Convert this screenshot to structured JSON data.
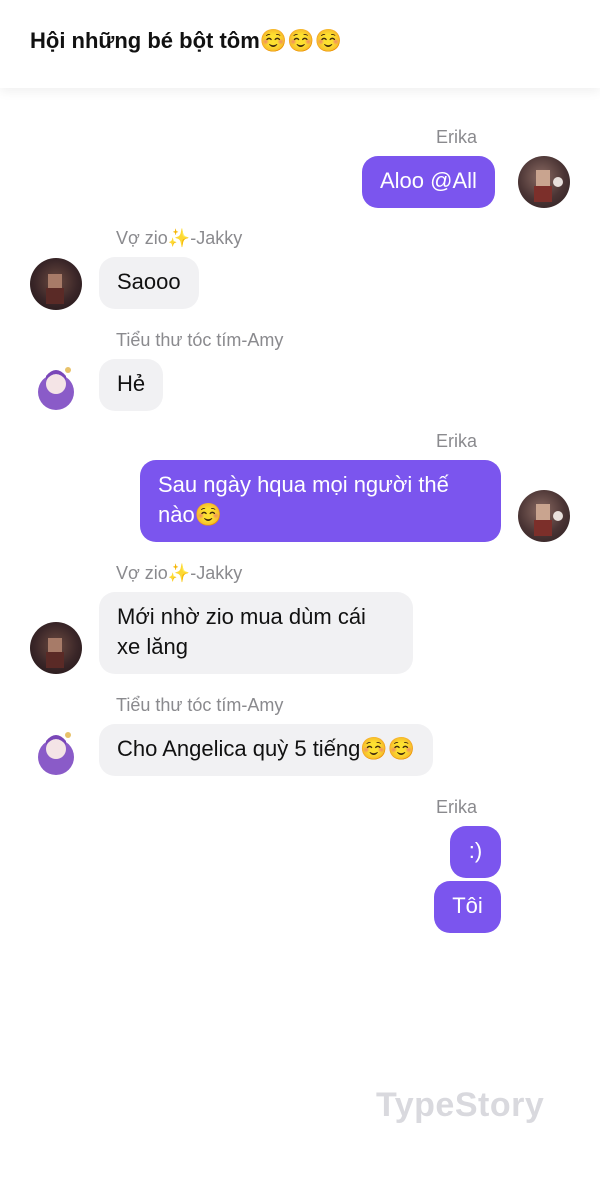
{
  "header": {
    "title": "Hội những bé bột tôm☺️☺️☺️"
  },
  "messages": [
    {
      "sender": "Erika",
      "direction": "outgoing",
      "text": "Aloo @All"
    },
    {
      "sender": "Vợ zio✨-Jakky",
      "direction": "incoming",
      "text": "Saooo"
    },
    {
      "sender": "Tiểu thư tóc tím-Amy",
      "direction": "incoming",
      "text": "Hẻ"
    },
    {
      "sender": "Erika",
      "direction": "outgoing",
      "text_line1": "Sau ngày hqua mọi người thế",
      "text_line2": "nào☺️"
    },
    {
      "sender": "Vợ zio✨-Jakky",
      "direction": "incoming",
      "text_line1": "Mới nhờ zio mua dùm cái",
      "text_line2": "xe lăng"
    },
    {
      "sender": "Tiểu thư tóc tím-Amy",
      "direction": "incoming",
      "text": "Cho Angelica quỳ 5 tiếng☺️☺️"
    },
    {
      "sender": "Erika",
      "direction": "outgoing",
      "texts": [
        ":)",
        "Tôi"
      ]
    }
  ],
  "watermark": "TypeStory",
  "colors": {
    "outgoing_bubble": "#7b55ee",
    "incoming_bubble": "#f1f1f3",
    "sender_name": "#8a8a8e"
  }
}
